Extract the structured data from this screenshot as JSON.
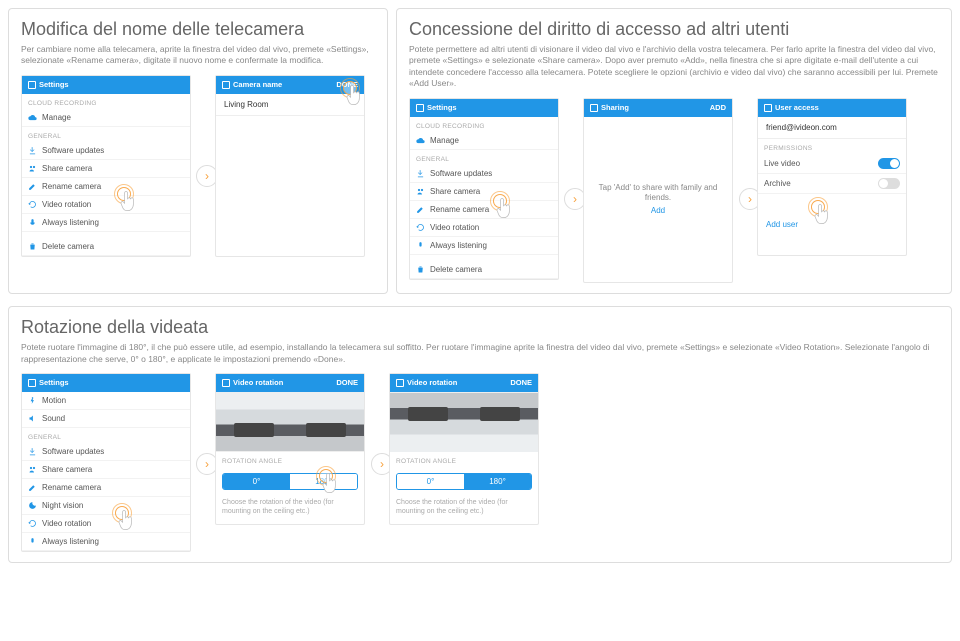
{
  "sec1": {
    "title": "Modifica del nome delle telecamera",
    "desc": "Per cambiare nome alla telecamera, aprite la finestra del video dal vivo, premete «Settings», selezionate «Rename camera», digitate il nuovo nome e confermate la modifica.",
    "p1": {
      "title": "Settings",
      "cloud": "CLOUD RECORDING",
      "manage": "Manage",
      "general": "GENERAL",
      "i1": "Software updates",
      "i2": "Share camera",
      "i3": "Rename camera",
      "i4": "Video rotation",
      "i5": "Always listening",
      "del": "Delete camera"
    },
    "p2": {
      "title": "Camera name",
      "done": "DONE",
      "value": "Living Room"
    }
  },
  "sec2": {
    "title": "Concessione del diritto di accesso ad altri utenti",
    "desc": "Potete permettere ad altri utenti di visionare il video dal vivo e l'archivio della vostra telecamera. Per farlo aprite la finestra del video dal vivo, premete «Settings» e selezionate «Share camera». Dopo aver premuto «Add», nella finestra che si apre digitate e-mail dell'utente a cui intendete concedere l'accesso alla telecamera. Potete scegliere le opzioni (archivio e video dal vivo) che saranno accessibili per lui. Premete «Add User».",
    "p1": {
      "title": "Settings"
    },
    "p2": {
      "title": "Sharing",
      "add": "ADD",
      "note": "Tap 'Add' to share with family and friends.",
      "addlink": "Add"
    },
    "p3": {
      "title": "User access",
      "email": "friend@ivideon.com",
      "perm": "PERMISSIONS",
      "live": "Live video",
      "arch": "Archive",
      "adduser": "Add user"
    }
  },
  "sec3": {
    "title": "Rotazione della videata",
    "desc": "Potete ruotare l'immagine di 180°, il che può essere utile, ad esempio, installando la telecamera sul soffitto. Per ruotare l'immagine aprite la finestra del video dal vivo, premete «Settings» e selezionate «Video Rotation». Selezionate l'angolo di rappresentazione che serve, 0° o 180°, e applicate le impostazioni premendo «Done».",
    "p1": {
      "title": "Settings",
      "i1": "Motion",
      "i2": "Sound",
      "general": "GENERAL",
      "g1": "Software updates",
      "g2": "Share camera",
      "g3": "Rename camera",
      "g4": "Night vision",
      "g5": "Video rotation",
      "g6": "Always listening"
    },
    "p23": {
      "title": "Video rotation",
      "done": "DONE",
      "label": "ROTATION ANGLE",
      "a0": "0°",
      "a180": "180°",
      "hint": "Choose the rotation of the video (for mounting on the ceiling etc.)"
    }
  }
}
